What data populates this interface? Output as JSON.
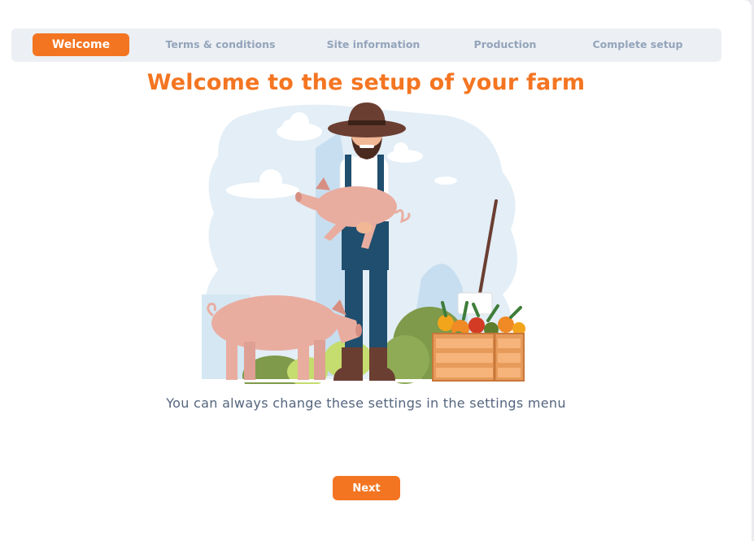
{
  "stepper": {
    "steps": [
      {
        "label": "Welcome",
        "active": true
      },
      {
        "label": "Terms & conditions",
        "active": false
      },
      {
        "label": "Site information",
        "active": false
      },
      {
        "label": "Production",
        "active": false
      },
      {
        "label": "Complete setup",
        "active": false
      }
    ]
  },
  "main": {
    "title": "Welcome to the setup of your farm",
    "subtitle": "You can always change these settings in the settings menu",
    "illustration": "farmer-with-pigs-and-vegetable-crate"
  },
  "footer": {
    "next_label": "Next"
  },
  "colors": {
    "accent": "#f47521",
    "step_inactive_text": "#93a4bb",
    "stepper_bg": "#eceff3",
    "subtitle_text": "#54657e"
  }
}
